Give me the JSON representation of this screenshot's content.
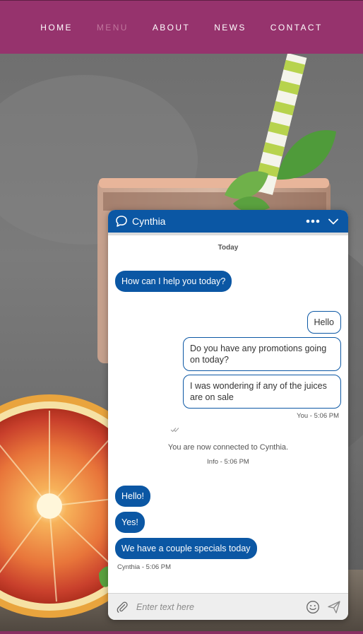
{
  "nav": {
    "items": [
      {
        "label": "HOME",
        "active": false
      },
      {
        "label": "MENU",
        "active": true
      },
      {
        "label": "ABOUT",
        "active": false
      },
      {
        "label": "NEWS",
        "active": false
      },
      {
        "label": "CONTACT",
        "active": false
      }
    ]
  },
  "colors": {
    "nav_bg": "#96336d",
    "nav_active": "#c0769d",
    "chat_accent": "#0b57a4"
  },
  "chat": {
    "header": {
      "icon": "chat-bubble-icon",
      "agent_name": "Cynthia",
      "more_icon": "more-dots-icon",
      "collapse_icon": "chevron-down-icon"
    },
    "day_label": "Today",
    "messages": {
      "agent_greeting": "How can I help you today?",
      "user_1": "Hello",
      "user_2": "Do you have any promotions going on today?",
      "user_3": "I was wondering if any of the juices are on sale",
      "user_meta": "You - 5:06 PM",
      "info_text": "You are now connected to Cynthia.",
      "info_meta": "Info - 5:06 PM",
      "agent_1": "Hello!",
      "agent_2": "Yes!",
      "agent_3": "We have a couple specials today",
      "agent_meta": "Cynthia - 5:06 PM"
    },
    "footer": {
      "placeholder": "Enter text here",
      "attach_icon": "paperclip-icon",
      "emoji_icon": "smiley-icon",
      "send_icon": "send-icon"
    }
  }
}
